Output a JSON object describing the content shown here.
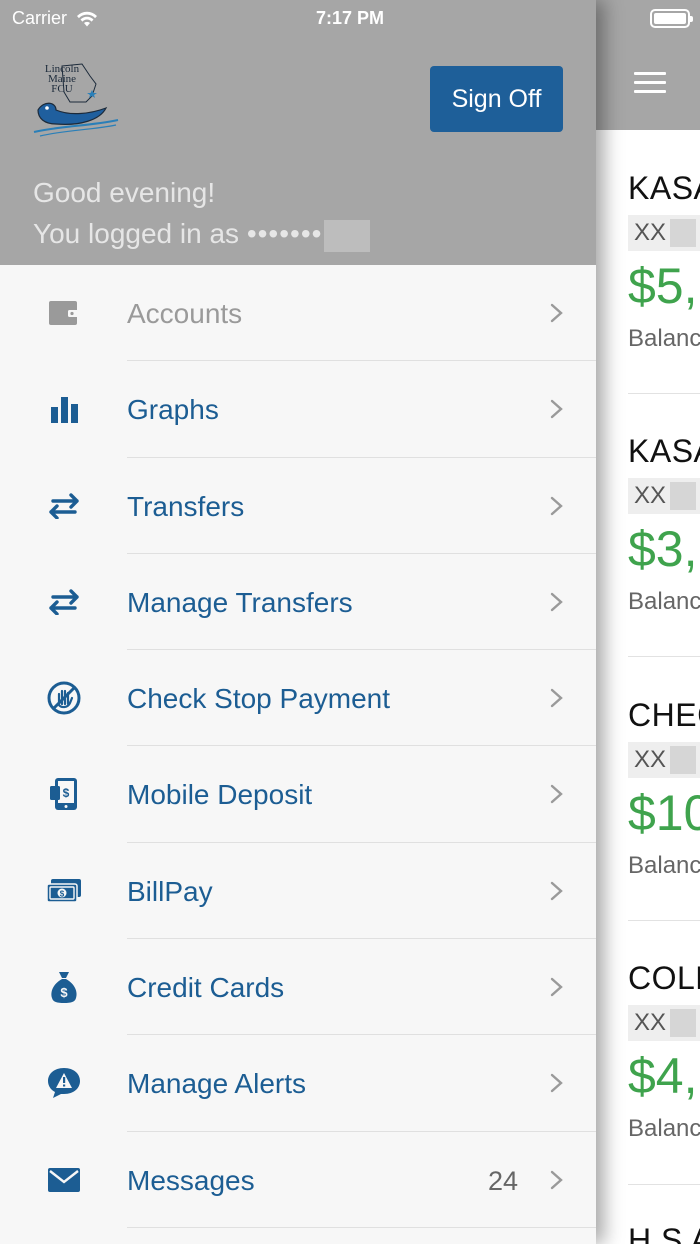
{
  "status_bar": {
    "carrier": "Carrier",
    "time": "7:17 PM"
  },
  "header": {
    "logo_text": [
      "Lincoln",
      "Maine",
      "FCU"
    ],
    "sign_off_label": "Sign Off",
    "greeting": "Good evening!",
    "logged_in_prefix": "You logged in as",
    "masked_user": "•••••••"
  },
  "menu": [
    {
      "label": "Accounts",
      "icon": "wallet-icon",
      "enabled": false,
      "count": ""
    },
    {
      "label": "Graphs",
      "icon": "bar-chart-icon",
      "enabled": true,
      "count": ""
    },
    {
      "label": "Transfers",
      "icon": "transfer-arrows-icon",
      "enabled": true,
      "count": ""
    },
    {
      "label": "Manage Transfers",
      "icon": "transfer-arrows-icon",
      "enabled": true,
      "count": ""
    },
    {
      "label": "Check Stop Payment",
      "icon": "stop-hand-icon",
      "enabled": true,
      "count": ""
    },
    {
      "label": "Mobile Deposit",
      "icon": "mobile-deposit-icon",
      "enabled": true,
      "count": ""
    },
    {
      "label": "BillPay",
      "icon": "cash-icon",
      "enabled": true,
      "count": ""
    },
    {
      "label": "Credit Cards",
      "icon": "money-bag-icon",
      "enabled": true,
      "count": ""
    },
    {
      "label": "Manage Alerts",
      "icon": "alert-bubble-icon",
      "enabled": true,
      "count": ""
    },
    {
      "label": "Messages",
      "icon": "envelope-icon",
      "enabled": true,
      "count": "24"
    }
  ],
  "accounts_preview": [
    {
      "name": "KASA",
      "number": "XX",
      "balance": "$5,",
      "label": "Balanc"
    },
    {
      "name": "KASA",
      "number": "XX",
      "balance": "$3,",
      "label": "Balanc"
    },
    {
      "name": "CHEC",
      "number": "XX",
      "balance": "$10",
      "label": "Balanc"
    },
    {
      "name": "COLL",
      "number": "XX",
      "balance": "$4,",
      "label": "Balanc"
    },
    {
      "name": "H S A",
      "number": "",
      "balance": "",
      "label": ""
    }
  ],
  "colors": {
    "accent": "#1c5d93",
    "button": "#1e5f99",
    "balance_green": "#3fa34d",
    "header_gray": "#a6a6a6"
  }
}
